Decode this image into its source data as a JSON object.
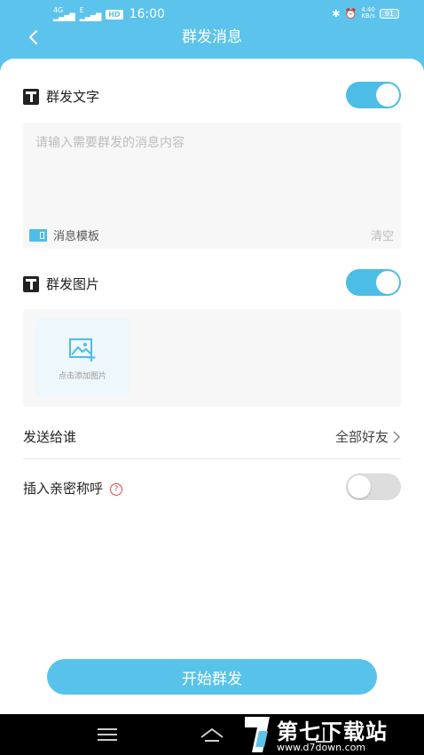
{
  "status_bar": {
    "signal1_label": "4G",
    "signal2_label": "E",
    "hd_badge": "HD",
    "time": "16:00",
    "net_speed_value": "4.40",
    "net_speed_unit": "KB/s",
    "battery": "91"
  },
  "header": {
    "title": "群发消息"
  },
  "text_section": {
    "title": "群发文字",
    "enabled": true,
    "placeholder": "请输入需要群发的消息内容",
    "template_label": "消息模板",
    "clear_label": "清空"
  },
  "image_section": {
    "title": "群发图片",
    "enabled": true,
    "add_label": "点击添加图片"
  },
  "send_to": {
    "label": "发送给谁",
    "value": "全部好友"
  },
  "nickname": {
    "label": "插入亲密称呼",
    "help": "?",
    "enabled": false
  },
  "start_button": "开始群发",
  "watermark": {
    "text": "第七下载站",
    "url": "www.d7down.com"
  },
  "colors": {
    "accent": "#5cc3ec",
    "toggle_on": "#4cbde6",
    "toggle_off": "#dddddd",
    "help": "#e64545"
  }
}
